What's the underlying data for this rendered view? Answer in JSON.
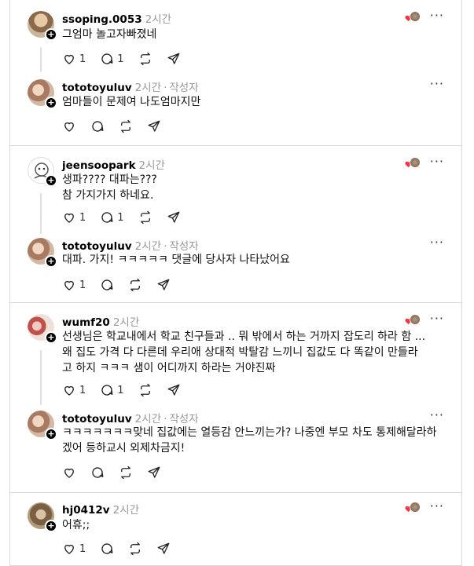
{
  "threads": [
    {
      "post": {
        "username": "ssoping.0053",
        "time": "2시간",
        "text": "그엄마 놀고자빠졌네",
        "likes": "1",
        "replies": "1"
      },
      "reply": {
        "username": "tototoyuluv",
        "time": "2시간",
        "author_tag": "작성자",
        "text": "엄마들이 문제여 나도엄마지만"
      }
    },
    {
      "post": {
        "username": "jeensoopark",
        "time": "2시간",
        "text": "생파???? 대파는???\n참 가지가지 하네요.",
        "likes": "1",
        "replies": "1"
      },
      "reply": {
        "username": "tototoyuluv",
        "time": "2시간",
        "author_tag": "작성자",
        "text": "대파. 가지! ㅋㅋㅋㅋㅋ 댓글에 당사자 나타났어요",
        "likes": "1"
      }
    },
    {
      "post": {
        "username": "wumf20",
        "time": "2시간",
        "text": "선생님은 학교내에서 학교 친구들과 .. 뭐 밖에서 하는 거까지 잡도리 하라 함 ...\n왜 집도 가격 다 다른데 우리애 상대적 박탈감 느끼니 집값도 다 똑같이 만들라\n고 하지 ㅋㅋㅋ 샘이 어디까지 하라는 거야진짜",
        "likes": "1",
        "replies": "1"
      },
      "reply": {
        "username": "tototoyuluv",
        "time": "2시간",
        "author_tag": "작성자",
        "text": "ㅋㅋㅋㅋㅋㅋㅋ맞네 집값에는 열등감 안느끼는가? 나중엔 부모 차도 통제해달라하\n겠어 등하교시 외제차금지!"
      }
    },
    {
      "post": {
        "username": "hj0412v",
        "time": "2시간",
        "text": "어휴;;",
        "likes": "1"
      }
    }
  ],
  "more_label": "···",
  "colors": {
    "divider": "#d9d9d9",
    "muted": "#999999",
    "heart": "#ff3040"
  },
  "icons": [
    "heart-icon",
    "comment-icon",
    "repost-icon",
    "share-icon",
    "more-icon",
    "plus-icon"
  ]
}
